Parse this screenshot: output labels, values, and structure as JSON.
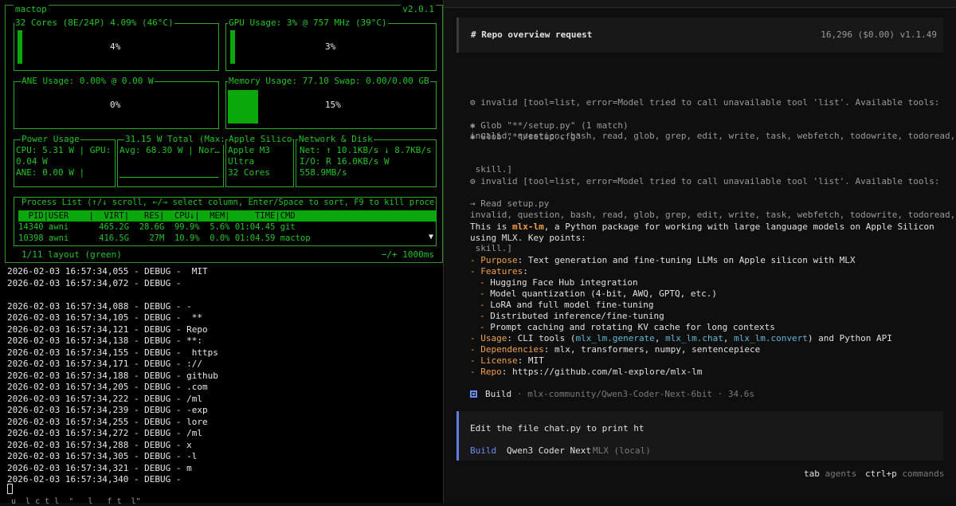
{
  "mactop": {
    "title": "mactop",
    "version": "v2.0.1",
    "cpu": {
      "title": "32 Cores (8E/24P) 4.09% (46°C)",
      "percent_label": "4%",
      "percent": 4
    },
    "gpu": {
      "title": "GPU Usage: 3% @ 757 MHz (39°C)",
      "percent_label": "3%",
      "percent": 3
    },
    "ane": {
      "title": "ANE Usage: 0.00% @ 0.00 W",
      "percent_label": "0%",
      "percent": 0
    },
    "memory": {
      "title": "Memory Usage: 77.10 Swap: 0.00/0.00 GB",
      "percent_label": "15%",
      "percent": 15
    },
    "power": {
      "title": "Power Usage",
      "lines": [
        "CPU: 5.31 W | GPU:",
        "0.04 W",
        "ANE: 0.00 W |"
      ]
    },
    "total": {
      "title": "31.15 W Total (Max:",
      "lines": [
        "Avg: 68.30 W | Nor…"
      ]
    },
    "apple": {
      "title": "Apple Silico",
      "lines": [
        "Apple M3",
        "Ultra",
        "32 Cores"
      ]
    },
    "network": {
      "title": "Network & Disk",
      "lines": [
        "Net: ↑ 10.1KB/s ↓ 8.7KB/s",
        "I/O: R 16.0KB/s W",
        "558.9MB/s"
      ]
    },
    "process": {
      "title": "Process List (↑/↓ scroll, ←/→ select column, Enter/Space to sort, F9 to kill proce",
      "header": "  PID|USER    |  VIRT|   RES|  CPU↓|  MEM|     TIME|CMD",
      "rows": [
        "14340 awni      465.2G  28.6G  99.9%  5.6% 01:04.45 git",
        "10398 awni      416.5G    27M  10.9%  0.0% 01:04.59 mactop"
      ],
      "scroll_indicator": "▼"
    },
    "layout_label": "1/11 layout (green)",
    "interval_label": "−/+ 1000ms"
  },
  "log_lines": [
    "2026-02-03 16:57:34,055 - DEBUG -  MIT",
    "2026-02-03 16:57:34,072 - DEBUG -",
    "",
    "2026-02-03 16:57:34,088 - DEBUG - -",
    "2026-02-03 16:57:34,105 - DEBUG -  **",
    "2026-02-03 16:57:34,121 - DEBUG - Repo",
    "2026-02-03 16:57:34,138 - DEBUG - **:",
    "2026-02-03 16:57:34,155 - DEBUG -  https",
    "2026-02-03 16:57:34,171 - DEBUG - ://",
    "2026-02-03 16:57:34,188 - DEBUG - github",
    "2026-02-03 16:57:34,205 - DEBUG - .com",
    "2026-02-03 16:57:34,222 - DEBUG - /ml",
    "2026-02-03 16:57:34,239 - DEBUG - -exp",
    "2026-02-03 16:57:34,255 - DEBUG - lore",
    "2026-02-03 16:57:34,272 - DEBUG - /ml",
    "2026-02-03 16:57:34,288 - DEBUG - x",
    "2026-02-03 16:57:34,305 - DEBUG - -l",
    "2026-02-03 16:57:34,321 - DEBUG - m",
    "2026-02-03 16:57:34,340 - DEBUG -"
  ],
  "log_cut_line": "u  l c t l  \"   l   f t  l\"",
  "session": {
    "header_title": "# Repo overview request",
    "header_meta": "16,296 ($0.00) v1.1.49",
    "error_1": [
      "⚙ invalid [tool=list, error=Model tried to call unavailable tool 'list'. Available tools:",
      "invalid, question, bash, read, glob, grep, edit, write, task, webfetch, todowrite, todoread,",
      " skill.]"
    ],
    "glob_1": "✱ Glob \"**/setup.py\" (1 match)",
    "glob_2": "✱ Glob \"**/setup.cfg\"",
    "error_2": [
      "⚙ invalid [tool=list, error=Model tried to call unavailable tool 'list'. Available tools:",
      "invalid, question, bash, read, glob, grep, edit, write, task, webfetch, todowrite, todoread,",
      " skill.]"
    ],
    "read": "→ Read setup.py",
    "intro_1_pre": "This is ",
    "intro_1_hl": "mlx-lm",
    "intro_1_post": ", a Python package for working with large language models on Apple Silicon",
    "intro_2": "using MLX. Key points:",
    "purpose_label": "Purpose",
    "purpose_text": ": Text generation and fine-tuning LLMs on Apple silicon with MLX",
    "features_label": "Features",
    "features": [
      "Hugging Face Hub integration",
      "Model quantization (4-bit, AWQ, GPTQ, etc.)",
      "LoRA and full model fine-tuning",
      "Distributed inference/fine-tuning",
      "Prompt caching and rotating KV cache for long contexts"
    ],
    "usage_label": "Usage",
    "usage_pre": ": CLI tools (",
    "usage_cmd1": "mlx_lm.generate",
    "usage_cmd2": "mlx_lm.chat",
    "usage_cmd3": "mlx_lm.convert",
    "usage_post": ") and Python API",
    "deps_label": "Dependencies",
    "deps_text": ": mlx, transformers, numpy, sentencepiece",
    "license_label": "License",
    "license_text": ": MIT",
    "repo_label": "Repo",
    "repo_text": ": https://github.com/ml-explore/mlx-lm",
    "build_label": "Build",
    "build_meta": "· mlx-community/Qwen3-Coder-Next-6bit · 34.6s",
    "prompt_text": "Edit the file chat.py to print ht",
    "prompt_mode": "Build",
    "prompt_model": "Qwen3 Coder Next",
    "prompt_provider": "MLX (local)",
    "footer_tab_key": "tab",
    "footer_tab_label": "agents",
    "footer_cmd_key": "ctrl+p",
    "footer_cmd_label": "commands"
  },
  "colors": {
    "terminal_green": "#22c322",
    "accent_orange": "#f0a04b",
    "accent_blue": "#5a7de8",
    "link_cyan": "#5fb8d6"
  }
}
